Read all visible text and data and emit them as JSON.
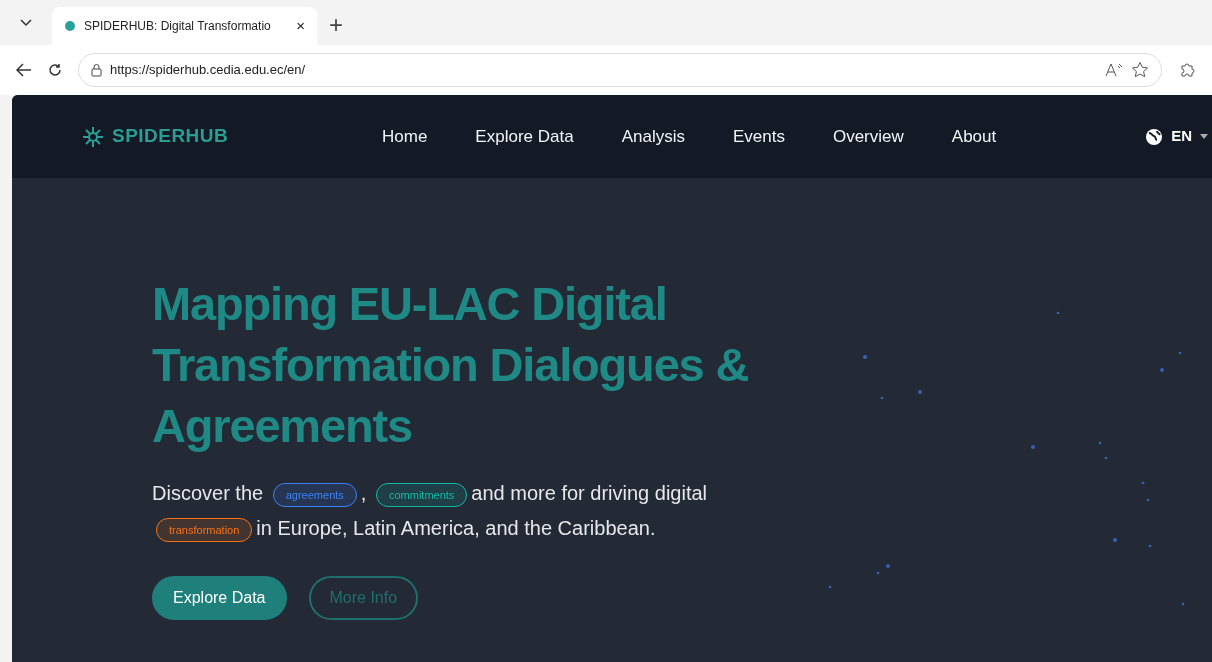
{
  "browser": {
    "tab_title": "SPIDERHUB: Digital Transformatio",
    "tab_close": "×",
    "new_tab": "+",
    "url": "https://spiderhub.cedia.edu.ec/en/"
  },
  "navbar": {
    "brand": "SPIDERHUB",
    "items": [
      {
        "label": "Home"
      },
      {
        "label": "Explore Data"
      },
      {
        "label": "Analysis"
      },
      {
        "label": "Events"
      },
      {
        "label": "Overview"
      },
      {
        "label": "About"
      }
    ],
    "language": "EN"
  },
  "hero": {
    "title": "Mapping EU-LAC Digital Transformation Dialogues & Agreements",
    "description": [
      {
        "kind": "text",
        "text": "Discover the"
      },
      {
        "kind": "tag",
        "text": "agreements",
        "color": "#3b82f6"
      },
      {
        "kind": "text",
        "text": ","
      },
      {
        "kind": "tag",
        "text": "commitments",
        "color": "#14b8a6"
      },
      {
        "kind": "text",
        "text": "and more for driving digital"
      },
      {
        "kind": "tag",
        "text": "transformation",
        "color": "#f97316"
      },
      {
        "kind": "text",
        "text": "in Europe, Latin America, and the Caribbean."
      }
    ],
    "buttons": [
      {
        "label": "Explore Data",
        "kind": "primary"
      },
      {
        "label": "More Info",
        "kind": "outline"
      }
    ]
  }
}
